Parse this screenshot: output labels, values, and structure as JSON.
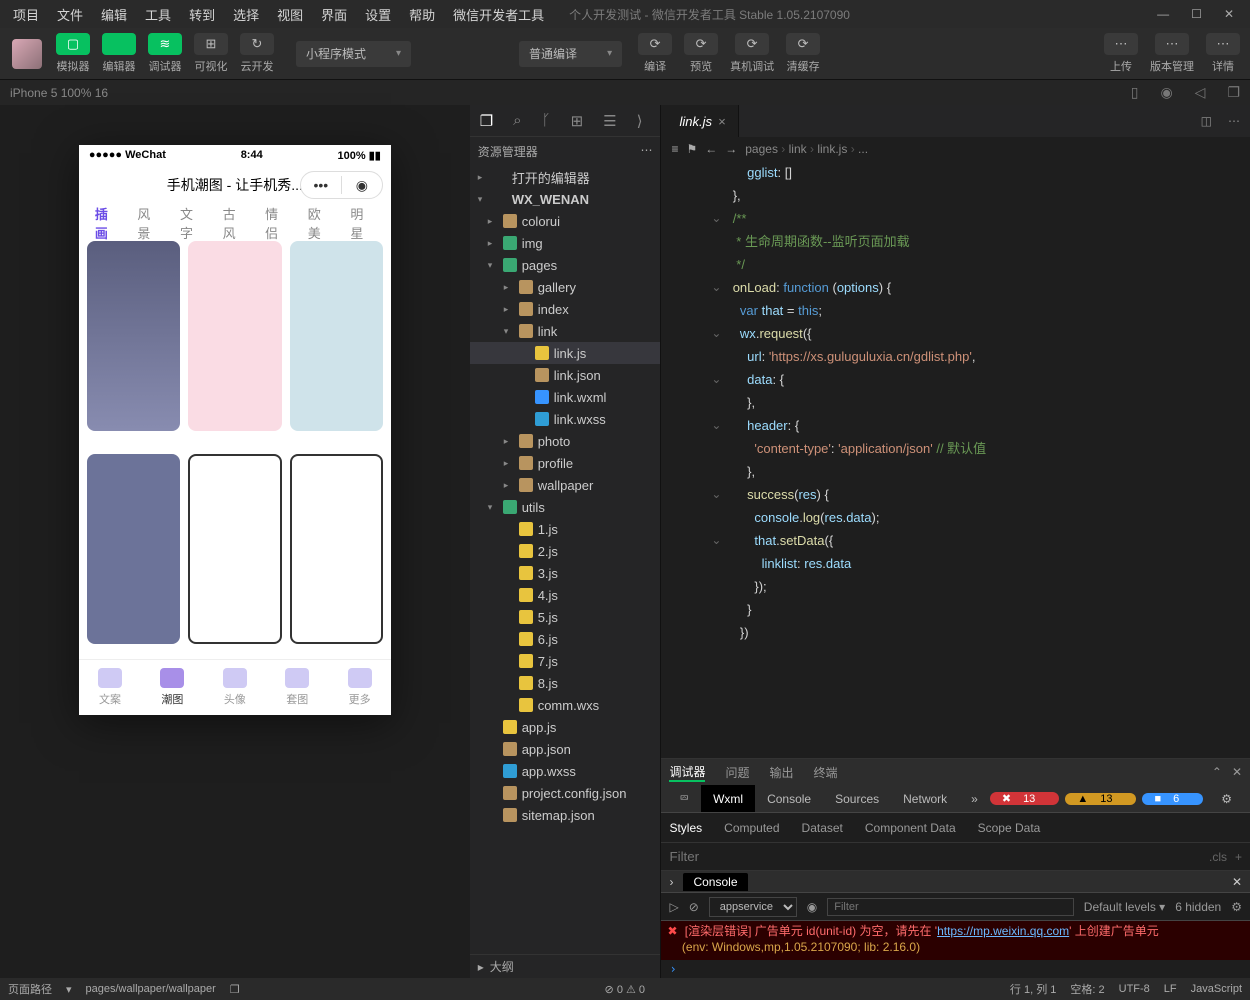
{
  "menubar": [
    "项目",
    "文件",
    "编辑",
    "工具",
    "转到",
    "选择",
    "视图",
    "界面",
    "设置",
    "帮助",
    "微信开发者工具"
  ],
  "title": "个人开发测试 - 微信开发者工具 Stable 1.05.2107090",
  "toolbar": {
    "left": [
      {
        "lbl": "模拟器",
        "cls": "green",
        "icon": "▢"
      },
      {
        "lbl": "编辑器",
        "cls": "green",
        "icon": "</>"
      },
      {
        "lbl": "调试器",
        "cls": "green",
        "icon": "≋"
      },
      {
        "lbl": "可视化",
        "cls": "dark",
        "icon": "⊞"
      },
      {
        "lbl": "云开发",
        "cls": "dark",
        "icon": "↻"
      }
    ],
    "mode": "小程序模式",
    "compile": "普通编译",
    "mid": [
      "编译",
      "预览",
      "真机调试",
      "清缓存"
    ],
    "right": [
      "上传",
      "版本管理",
      "详情"
    ]
  },
  "simbar": {
    "device": "iPhone 5 100% 16"
  },
  "phone": {
    "status": {
      "l": "●●●●● WeChat",
      "c": "8:44",
      "r": "100%"
    },
    "title": "手机潮图 - 让手机秀...",
    "tabs": [
      "插画",
      "风景",
      "文字",
      "古风",
      "情侣",
      "欧美",
      "明星"
    ],
    "btabs": [
      "文案",
      "潮图",
      "头像",
      "套图",
      "更多"
    ],
    "active_btab": 1
  },
  "explorer": {
    "header": "资源管理器",
    "tree": [
      {
        "d": 0,
        "c": "▸",
        "t": "folder",
        "lbl": "打开的编辑器"
      },
      {
        "d": 0,
        "c": "▾",
        "t": "folder",
        "lbl": "WX_WENAN",
        "bold": true
      },
      {
        "d": 1,
        "c": "▸",
        "t": "ffolder",
        "lbl": "colorui"
      },
      {
        "d": 1,
        "c": "▸",
        "t": "fpages",
        "lbl": "img"
      },
      {
        "d": 1,
        "c": "▾",
        "t": "fpages",
        "lbl": "pages"
      },
      {
        "d": 2,
        "c": "▸",
        "t": "ffolder",
        "lbl": "gallery"
      },
      {
        "d": 2,
        "c": "▸",
        "t": "ffolder",
        "lbl": "index"
      },
      {
        "d": 2,
        "c": "▾",
        "t": "ffolder",
        "lbl": "link"
      },
      {
        "d": 3,
        "c": "",
        "t": "fjs",
        "lbl": "link.js",
        "active": true
      },
      {
        "d": 3,
        "c": "",
        "t": "fjson",
        "lbl": "link.json"
      },
      {
        "d": 3,
        "c": "",
        "t": "fwxml",
        "lbl": "link.wxml"
      },
      {
        "d": 3,
        "c": "",
        "t": "fwxss",
        "lbl": "link.wxss"
      },
      {
        "d": 2,
        "c": "▸",
        "t": "ffolder",
        "lbl": "photo"
      },
      {
        "d": 2,
        "c": "▸",
        "t": "ffolder",
        "lbl": "profile"
      },
      {
        "d": 2,
        "c": "▸",
        "t": "ffolder",
        "lbl": "wallpaper"
      },
      {
        "d": 1,
        "c": "▾",
        "t": "fpages",
        "lbl": "utils"
      },
      {
        "d": 2,
        "c": "",
        "t": "fjs",
        "lbl": "1.js"
      },
      {
        "d": 2,
        "c": "",
        "t": "fjs",
        "lbl": "2.js"
      },
      {
        "d": 2,
        "c": "",
        "t": "fjs",
        "lbl": "3.js"
      },
      {
        "d": 2,
        "c": "",
        "t": "fjs",
        "lbl": "4.js"
      },
      {
        "d": 2,
        "c": "",
        "t": "fjs",
        "lbl": "5.js"
      },
      {
        "d": 2,
        "c": "",
        "t": "fjs",
        "lbl": "6.js"
      },
      {
        "d": 2,
        "c": "",
        "t": "fjs",
        "lbl": "7.js"
      },
      {
        "d": 2,
        "c": "",
        "t": "fjs",
        "lbl": "8.js"
      },
      {
        "d": 2,
        "c": "",
        "t": "fwxs",
        "lbl": "comm.wxs"
      },
      {
        "d": 1,
        "c": "",
        "t": "fjs",
        "lbl": "app.js"
      },
      {
        "d": 1,
        "c": "",
        "t": "fjson",
        "lbl": "app.json"
      },
      {
        "d": 1,
        "c": "",
        "t": "fwxss",
        "lbl": "app.wxss"
      },
      {
        "d": 1,
        "c": "",
        "t": "fjson",
        "lbl": "project.config.json"
      },
      {
        "d": 1,
        "c": "",
        "t": "fjson",
        "lbl": "sitemap.json"
      }
    ],
    "outline": "大纲"
  },
  "editor": {
    "tab": "link.js",
    "crumbs": [
      "pages",
      "link",
      "link.js",
      "..."
    ],
    "lines": [
      {
        "n": "",
        "f": "",
        "h": "      <span class='c-prop'>gglist</span>: []"
      },
      {
        "n": "",
        "f": "",
        "h": "  },"
      },
      {
        "n": "",
        "f": "",
        "h": ""
      },
      {
        "n": "",
        "f": "⌄",
        "h": "  <span class='c-com'>/**</span>"
      },
      {
        "n": "",
        "f": "",
        "h": "<span class='c-com'>   * 生命周期函数--监听页面加载</span>"
      },
      {
        "n": "",
        "f": "",
        "h": "<span class='c-com'>   */</span>"
      },
      {
        "n": "",
        "f": "⌄",
        "h": "  <span class='c-fn'>onLoad</span>: <span class='c-kw'>function</span> (<span class='c-prop'>options</span>) {"
      },
      {
        "n": "",
        "f": "",
        "h": "    <span class='c-kw'>var</span> <span class='c-prop'>that</span> = <span class='c-kw'>this</span>;"
      },
      {
        "n": "",
        "f": "⌄",
        "h": "    <span class='c-prop'>wx</span>.<span class='c-fn'>request</span>({"
      },
      {
        "n": "",
        "f": "",
        "h": "      <span class='c-prop'>url</span>: <span class='c-str'>'https://xs.guluguluxia.cn/gdlist.php'</span>,"
      },
      {
        "n": "",
        "f": "⌄",
        "h": "      <span class='c-prop'>data</span>: {"
      },
      {
        "n": "",
        "f": "",
        "h": "      },"
      },
      {
        "n": "",
        "f": "⌄",
        "h": "      <span class='c-prop'>header</span>: {"
      },
      {
        "n": "",
        "f": "",
        "h": "        <span class='c-str'>'content-type'</span>: <span class='c-str'>'application/json'</span> <span class='c-com'>// 默认值</span>"
      },
      {
        "n": "",
        "f": "",
        "h": "      },"
      },
      {
        "n": "",
        "f": "⌄",
        "h": "      <span class='c-fn'>success</span>(<span class='c-prop'>res</span>) {"
      },
      {
        "n": "",
        "f": "",
        "h": "        <span class='c-prop'>console</span>.<span class='c-fn'>log</span>(<span class='c-prop'>res</span>.<span class='c-prop'>data</span>);"
      },
      {
        "n": "",
        "f": "⌄",
        "h": "        <span class='c-prop'>that</span>.<span class='c-fn'>setData</span>({"
      },
      {
        "n": "",
        "f": "",
        "h": "          <span class='c-prop'>linklist</span>: <span class='c-prop'>res</span>.<span class='c-prop'>data</span>"
      },
      {
        "n": "",
        "f": "",
        "h": "        });"
      },
      {
        "n": "",
        "f": "",
        "h": "      }"
      },
      {
        "n": "",
        "f": "",
        "h": "    })"
      }
    ]
  },
  "debugger": {
    "tabs": [
      "调试器",
      "问题",
      "输出",
      "终端"
    ],
    "devtabs": [
      "Wxml",
      "Console",
      "Sources",
      "Network"
    ],
    "err": {
      "red": "13",
      "yel": "13",
      "blu": "6"
    },
    "styletabs": [
      "Styles",
      "Computed",
      "Dataset",
      "Component Data",
      "Scope Data"
    ],
    "filter": "Filter",
    "cls": ".cls",
    "console_label": "Console",
    "context": "appservice",
    "levels": "Default levels",
    "hidden": "6 hidden",
    "filter2": "Filter",
    "errtext": "[渲染层错误] 广告单元 id(unit-id) 为空，请先在 '",
    "errlink": "https://mp.weixin.qq.com",
    "errtext2": "' 上创建广告单元",
    "env": "(env: Windows,mp,1.05.2107090; lib: 2.16.0)"
  },
  "statusbar": {
    "left": {
      "label": "页面路径",
      "path": "pages/wallpaper/wallpaper"
    },
    "center": "⊘ 0 ⚠ 0",
    "right": [
      "行 1, 列 1",
      "空格: 2",
      "UTF-8",
      "LF",
      "JavaScript"
    ]
  }
}
